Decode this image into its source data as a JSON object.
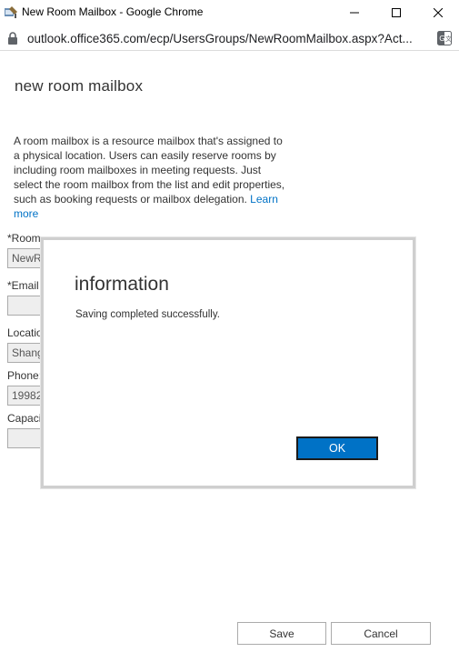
{
  "window": {
    "title": "New Room Mailbox - Google Chrome",
    "icon": "mailbox-app-icon"
  },
  "browser": {
    "url": "outlook.office365.com/ecp/UsersGroups/NewRoomMailbox.aspx?Act...",
    "lock_icon": "lock-icon",
    "translate_icon": "translate-icon"
  },
  "page": {
    "title": "new room mailbox",
    "description": "A room mailbox is a resource mailbox that's assigned to a physical location. Users can easily reserve rooms by including room mailboxes in meeting requests. Just select the room mailbox from the list and edit properties, such as booking requests or mailbox delegation.",
    "learn_more": "Learn more",
    "fields": {
      "room_label": "*Room",
      "room_value": "NewRo",
      "email_label": "*Email",
      "email_value": "",
      "location_label": "Locatio",
      "location_value": "Shang",
      "phone_label": "Phone:",
      "phone_value": "19982",
      "capacity_label": "Capacit",
      "capacity_value": ""
    },
    "save_label": "Save",
    "cancel_label": "Cancel"
  },
  "dialog": {
    "title": "information",
    "message": "Saving completed successfully.",
    "ok_label": "OK"
  },
  "colors": {
    "accent": "#0072c6",
    "link": "#0072c6"
  }
}
